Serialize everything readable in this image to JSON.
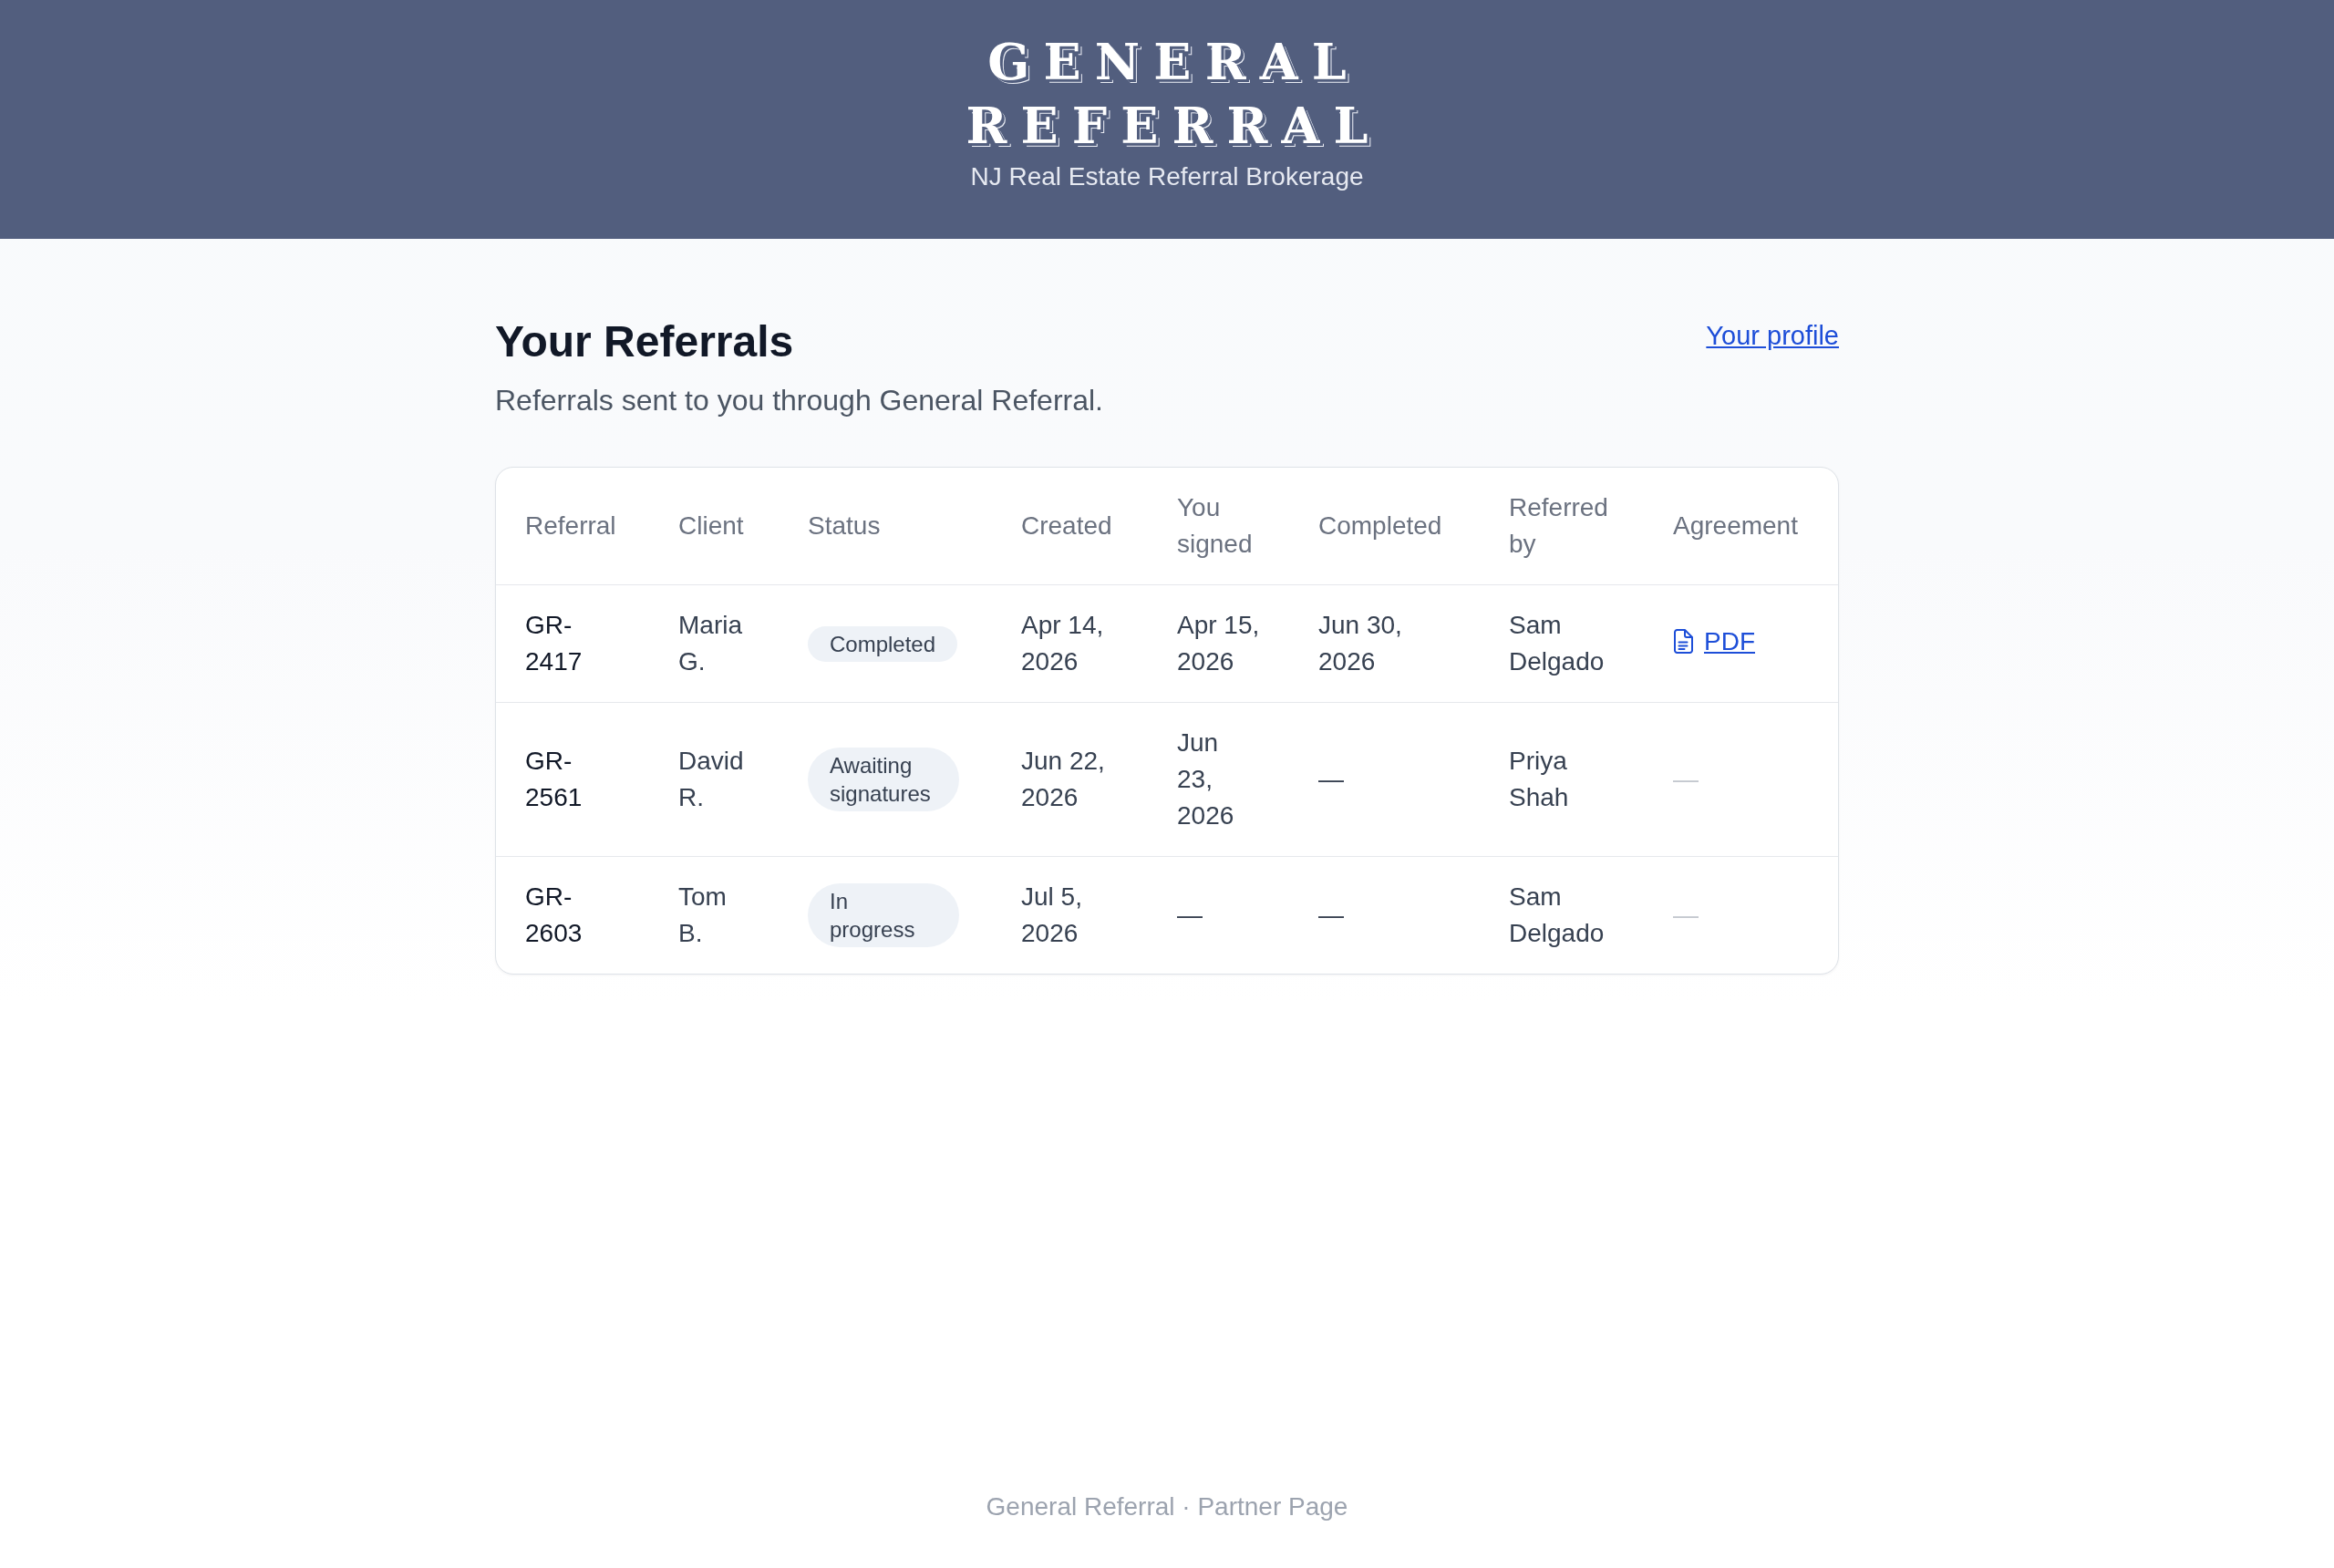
{
  "header": {
    "title": "GENERAL REFERRAL",
    "subtitle": "NJ Real Estate Referral Brokerage"
  },
  "page": {
    "title": "Your Referrals",
    "description": "Referrals sent to you through General Referral.",
    "profile_link": "Your profile"
  },
  "table": {
    "columns": [
      "Referral",
      "Client",
      "Status",
      "Created",
      "You signed",
      "Completed",
      "Referred by",
      "Agreement"
    ],
    "rows": [
      {
        "referral": "GR-2417",
        "client": "Maria G.",
        "status": "Completed",
        "created": "Apr 14, 2026",
        "you_signed": "Apr 15, 2026",
        "completed": "Jun 30, 2026",
        "referred_by": "Sam Delgado",
        "agreement": {
          "kind": "link",
          "text": "PDF"
        }
      },
      {
        "referral": "GR-2561",
        "client": "David R.",
        "status": "Awaiting signatures",
        "created": "Jun 22, 2026",
        "you_signed": "Jun 23, 2026",
        "completed": "—",
        "referred_by": "Priya Shah",
        "agreement": {
          "kind": "none",
          "text": "—"
        }
      },
      {
        "referral": "GR-2603",
        "client": "Tom B.",
        "status": "In progress",
        "created": "Jul 5, 2026",
        "you_signed": "—",
        "completed": "—",
        "referred_by": "Sam Delgado",
        "agreement": {
          "kind": "none",
          "text": "—"
        }
      }
    ]
  },
  "footer": {
    "text": "General Referral · Partner Page"
  }
}
